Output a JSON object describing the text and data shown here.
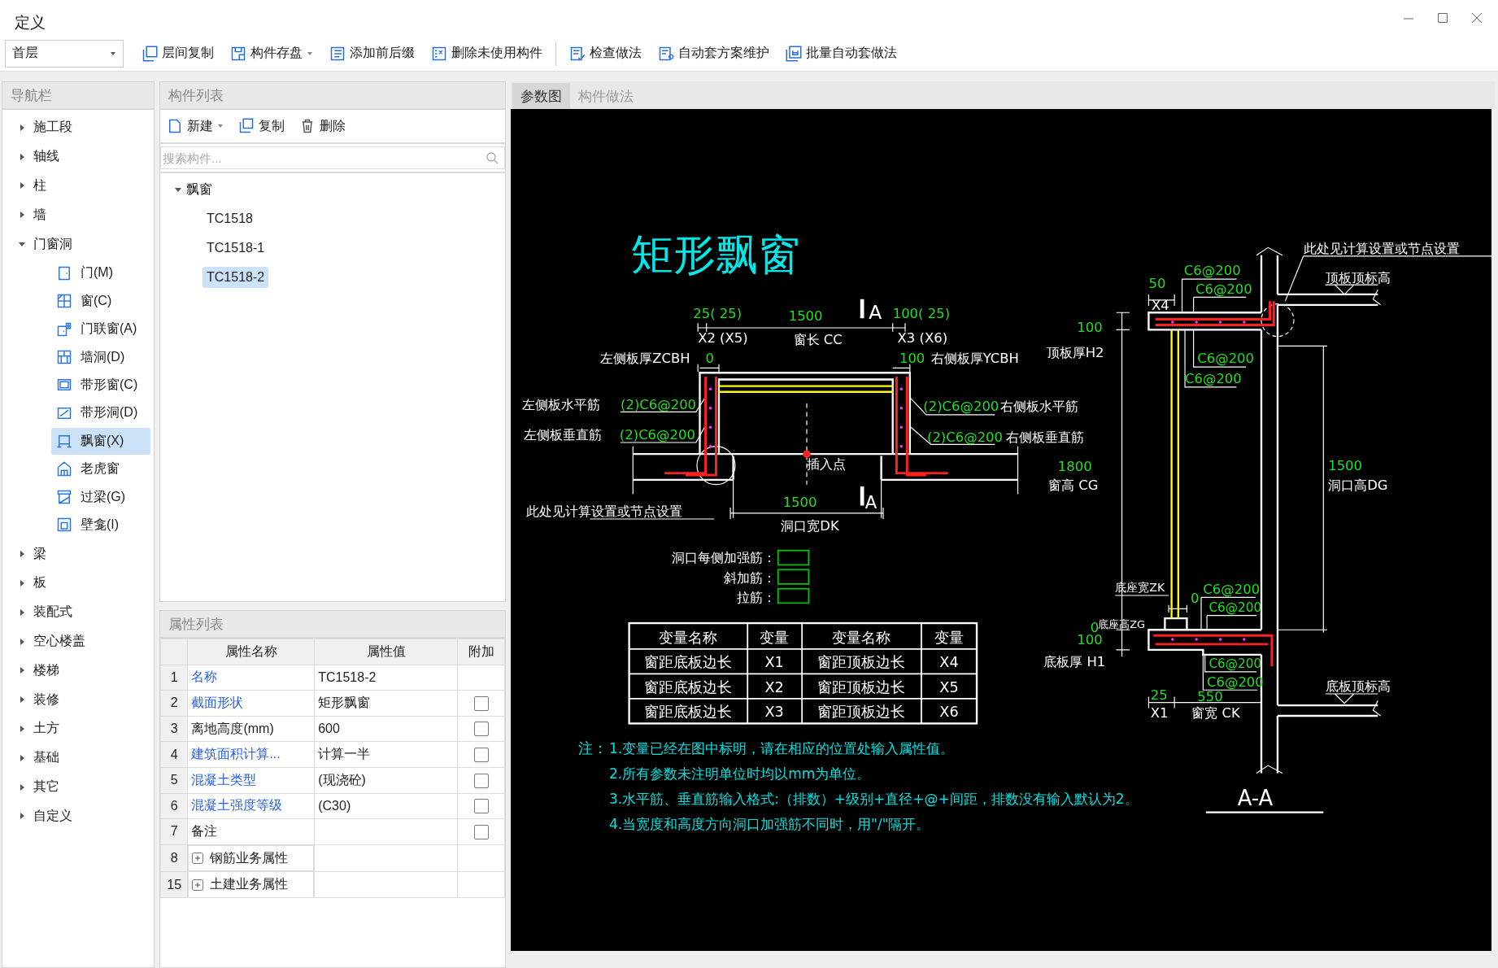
{
  "window": {
    "title": "定义"
  },
  "toolbar": {
    "floor": "首层",
    "groups": [
      [
        {
          "label": "层间复制",
          "has_menu": false
        },
        {
          "label": "构件存盘",
          "has_menu": true
        },
        {
          "label": "添加前后缀",
          "has_menu": false
        },
        {
          "label": "删除未使用构件",
          "has_menu": false
        }
      ],
      [
        {
          "label": "检查做法",
          "has_menu": false
        },
        {
          "label": "自动套方案维护",
          "has_menu": false
        },
        {
          "label": "批量自动套做法",
          "has_menu": false
        }
      ]
    ]
  },
  "nav": {
    "title": "导航栏",
    "items": [
      {
        "label": "施工段",
        "expanded": false
      },
      {
        "label": "轴线",
        "expanded": false
      },
      {
        "label": "柱",
        "expanded": false
      },
      {
        "label": "墙",
        "expanded": false
      },
      {
        "label": "门窗洞",
        "expanded": true,
        "children": [
          {
            "label": "门(M)",
            "selected": false
          },
          {
            "label": "窗(C)",
            "selected": false
          },
          {
            "label": "门联窗(A)",
            "selected": false
          },
          {
            "label": "墙洞(D)",
            "selected": false
          },
          {
            "label": "带形窗(C)",
            "selected": false
          },
          {
            "label": "带形洞(D)",
            "selected": false
          },
          {
            "label": "飘窗(X)",
            "selected": true
          },
          {
            "label": "老虎窗",
            "selected": false
          },
          {
            "label": "过梁(G)",
            "selected": false
          },
          {
            "label": "壁龛(I)",
            "selected": false
          }
        ]
      },
      {
        "label": "梁",
        "expanded": false
      },
      {
        "label": "板",
        "expanded": false
      },
      {
        "label": "装配式",
        "expanded": false
      },
      {
        "label": "空心楼盖",
        "expanded": false
      },
      {
        "label": "楼梯",
        "expanded": false
      },
      {
        "label": "装修",
        "expanded": false
      },
      {
        "label": "土方",
        "expanded": false
      },
      {
        "label": "基础",
        "expanded": false
      },
      {
        "label": "其它",
        "expanded": false
      },
      {
        "label": "自定义",
        "expanded": false
      }
    ]
  },
  "component_list": {
    "title": "构件列表",
    "actions": [
      {
        "label": "新建",
        "has_menu": true
      },
      {
        "label": "复制",
        "has_menu": false
      },
      {
        "label": "删除",
        "has_menu": false
      }
    ],
    "search": {
      "placeholder": "搜索构件..."
    },
    "tree": [
      {
        "label": "飘窗",
        "expanded": true,
        "children": [
          {
            "label": "TC1518",
            "selected": false
          },
          {
            "label": "TC1518-1",
            "selected": false
          },
          {
            "label": "TC1518-2",
            "selected": true
          }
        ]
      }
    ]
  },
  "properties": {
    "title": "属性列表",
    "columns": [
      "属性名称",
      "属性值",
      "附加"
    ],
    "rows": [
      {
        "index": "1",
        "name": "名称",
        "value": "TC1518-2",
        "kind": "plain",
        "linked": true
      },
      {
        "index": "2",
        "name": "截面形状",
        "value": "矩形飘窗",
        "kind": "check",
        "linked": true,
        "checked": false
      },
      {
        "index": "3",
        "name": "离地高度(mm)",
        "value": "600",
        "kind": "check",
        "linked": false,
        "checked": false
      },
      {
        "index": "4",
        "name": "建筑面积计算...",
        "value": "计算一半",
        "kind": "check",
        "linked": true,
        "checked": false
      },
      {
        "index": "5",
        "name": "混凝土类型",
        "value": "(现浇砼)",
        "kind": "check",
        "linked": true,
        "checked": false
      },
      {
        "index": "6",
        "name": "混凝土强度等级",
        "value": "(C30)",
        "kind": "check",
        "linked": true,
        "checked": false
      },
      {
        "index": "7",
        "name": "备注",
        "value": "",
        "kind": "check",
        "linked": false,
        "checked": false
      },
      {
        "index": "8",
        "name": "钢筋业务属性",
        "kind": "group",
        "expanded": false
      },
      {
        "index": "15",
        "name": "土建业务属性",
        "kind": "group",
        "expanded": false
      }
    ]
  },
  "tabs": [
    {
      "label": "参数图",
      "selected": true
    },
    {
      "label": "构件做法",
      "selected": false
    }
  ],
  "drawing": {
    "title": "矩形飘窗",
    "labels": [
      {
        "text": "25( 25)",
        "kind": "value"
      },
      {
        "text": "1500",
        "kind": "value"
      },
      {
        "text": "A",
        "kind": "label"
      },
      {
        "text": "100( 25)",
        "kind": "value"
      },
      {
        "text": "X2 (X5)",
        "kind": "label"
      },
      {
        "text": "窗长 CC",
        "kind": "label"
      },
      {
        "text": "X3 (X6)",
        "kind": "label"
      },
      {
        "text": "左侧板厚ZCBH",
        "kind": "label"
      },
      {
        "text": "0",
        "kind": "value"
      },
      {
        "text": "100",
        "kind": "value"
      },
      {
        "text": "右侧板厚YCBH",
        "kind": "label"
      },
      {
        "text": "左侧板水平筋",
        "kind": "label"
      },
      {
        "text": "(2)C6@200",
        "kind": "value"
      },
      {
        "text": "(2)C6@200",
        "kind": "value"
      },
      {
        "text": "右侧板水平筋",
        "kind": "label"
      },
      {
        "text": "左侧板垂直筋",
        "kind": "label"
      },
      {
        "text": "(2)C6@200",
        "kind": "value"
      },
      {
        "text": "(2)C6@200",
        "kind": "value"
      },
      {
        "text": "右侧板垂直筋",
        "kind": "label"
      },
      {
        "text": "插入点",
        "kind": "label"
      },
      {
        "text": "1500",
        "kind": "value"
      },
      {
        "text": "A",
        "kind": "label"
      },
      {
        "text": "此处见计算设置或节点设置",
        "kind": "label"
      },
      {
        "text": "洞口宽DK",
        "kind": "label"
      },
      {
        "text": "此处见计算设置或节点设置",
        "kind": "label"
      },
      {
        "text": "顶板顶标高",
        "kind": "label"
      },
      {
        "text": "50",
        "kind": "value"
      },
      {
        "text": "C6@200",
        "kind": "value"
      },
      {
        "text": "C6@200",
        "kind": "value"
      },
      {
        "text": "X4",
        "kind": "label"
      },
      {
        "text": "100",
        "kind": "value"
      },
      {
        "text": "顶板厚H2",
        "kind": "label"
      },
      {
        "text": "C6@200",
        "kind": "value"
      },
      {
        "text": "C6@200",
        "kind": "value"
      },
      {
        "text": "1800",
        "kind": "value"
      },
      {
        "text": "窗高 CG",
        "kind": "label"
      },
      {
        "text": "1500",
        "kind": "value"
      },
      {
        "text": "洞口高DG",
        "kind": "label"
      },
      {
        "text": "底座宽ZK",
        "kind": "label"
      },
      {
        "text": "0",
        "kind": "value"
      },
      {
        "text": "C6@200",
        "kind": "value"
      },
      {
        "text": "C6@200",
        "kind": "value"
      },
      {
        "text": "0",
        "kind": "value"
      },
      {
        "text": "底座高ZG",
        "kind": "label"
      },
      {
        "text": "100",
        "kind": "value"
      },
      {
        "text": "底板厚 H1",
        "kind": "label"
      },
      {
        "text": "C6@200",
        "kind": "value"
      },
      {
        "text": "C6@200",
        "kind": "value"
      },
      {
        "text": "底板顶标高",
        "kind": "label"
      },
      {
        "text": "25",
        "kind": "value"
      },
      {
        "text": "550",
        "kind": "value"
      },
      {
        "text": "X1",
        "kind": "label"
      },
      {
        "text": "窗宽 CK",
        "kind": "label"
      },
      {
        "text": "A-A",
        "kind": "label"
      }
    ],
    "inputs": [
      "洞口每侧加强筋：",
      "斜加筋：",
      "拉筋："
    ],
    "table": [
      [
        "变量名称",
        "变量",
        "变量名称",
        "变量"
      ],
      [
        "窗距底板边长",
        "X1",
        "窗距顶板边长",
        "X4"
      ],
      [
        "窗距底板边长",
        "X2",
        "窗距顶板边长",
        "X5"
      ],
      [
        "窗距底板边长",
        "X3",
        "窗距顶板边长",
        "X6"
      ]
    ],
    "note_mark": "注：",
    "notes": [
      "1.变量已经在图中标明，请在相应的位置处输入属性值。",
      "2.所有参数未注明单位时均以mm为单位。",
      "3.水平筋、垂直筋输入格式:（排数）+级别+直径+@+间距，排数没有输入默认为2。",
      "4.当宽度和高度方向洞口加强筋不同时，用\"/\"隔开。"
    ]
  }
}
